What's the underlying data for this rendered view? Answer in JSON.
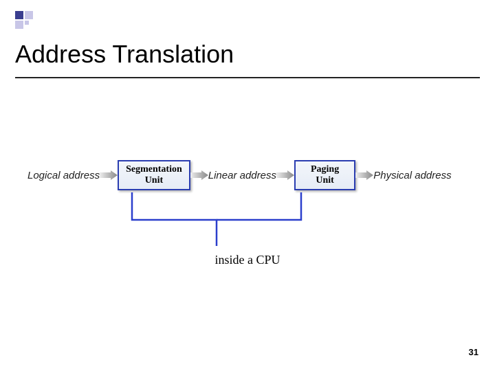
{
  "title": "Address Translation",
  "diagram": {
    "addr1": "Logical address",
    "unit1_line1": "Segmentation",
    "unit1_line2": "Unit",
    "addr2": "Linear address",
    "unit2_line1": "Paging",
    "unit2_line2": "Unit",
    "addr3": "Physical address",
    "caption": "inside a CPU"
  },
  "page_number": "31"
}
